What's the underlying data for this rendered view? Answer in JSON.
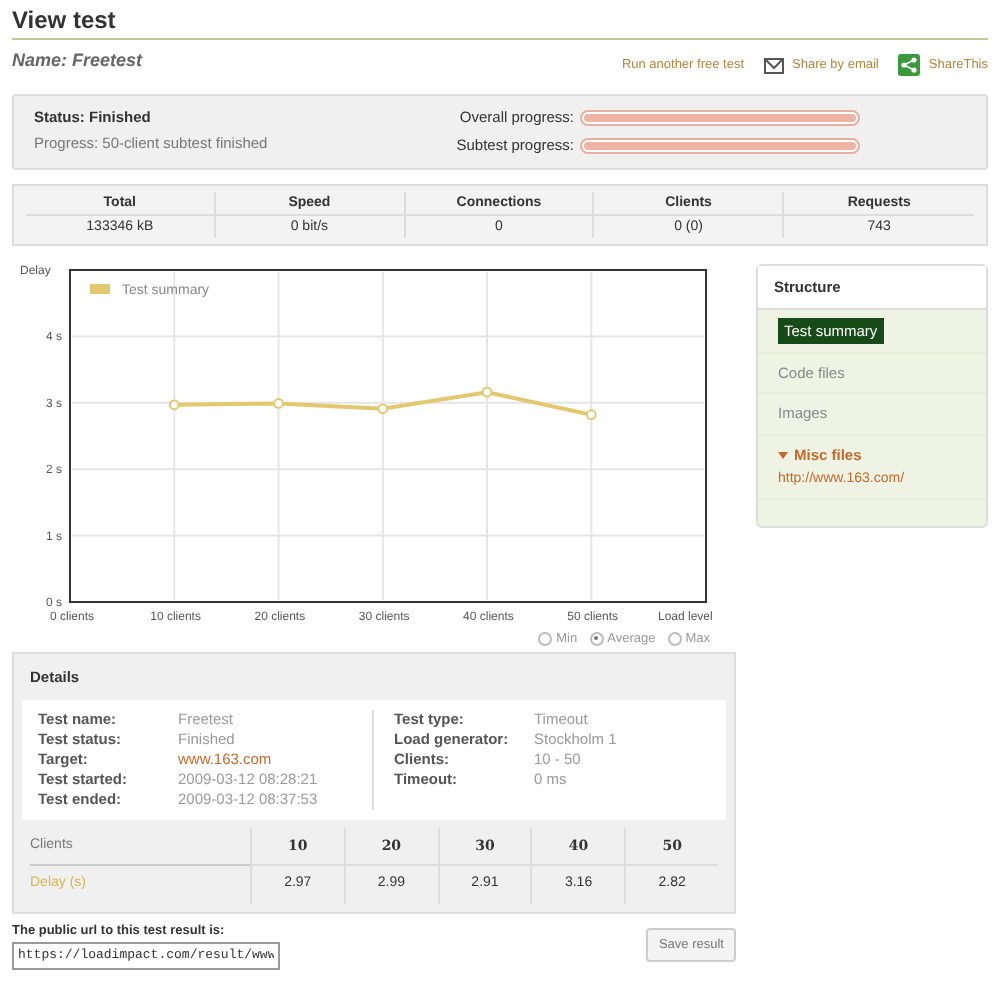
{
  "title": "View test",
  "name": "Name: Freetest",
  "actions": [
    {
      "kind": "link",
      "label": "Run another free test"
    },
    {
      "kind": "email",
      "label": "Share by email"
    },
    {
      "kind": "share",
      "label": "ShareThis"
    }
  ],
  "status": {
    "title": "Status: Finished",
    "progress_text": "Progress: 50-client subtest finished",
    "bars": [
      {
        "label": "Overall progress:",
        "level": 1
      },
      {
        "label": "Subtest progress:",
        "level": 1
      }
    ]
  },
  "stats": {
    "columns": [
      "Total",
      "Speed",
      "Connections",
      "Clients",
      "Requests"
    ],
    "values": [
      "133346 kB",
      "0 bit/s",
      "0",
      "0 (0)",
      "743"
    ]
  },
  "chart": {
    "chart_data": {
      "type": "line",
      "grid": true,
      "ylabel": "Delay",
      "xlabel": "Load level",
      "x": [
        10,
        20,
        30,
        40,
        50
      ],
      "series": [
        {
          "name": "Test summary",
          "color": "#e3c870",
          "marker": "circle",
          "values": [
            2.97,
            2.99,
            2.91,
            3.16,
            2.82
          ]
        }
      ],
      "xlim": [
        0,
        61
      ],
      "ylim": [
        0,
        5
      ],
      "xticks": [
        {
          "value": 0,
          "label": "0 clients"
        },
        {
          "value": 10,
          "label": "10 clients"
        },
        {
          "value": 20,
          "label": "20 clients"
        },
        {
          "value": 30,
          "label": "30 clients"
        },
        {
          "value": 40,
          "label": "40 clients"
        },
        {
          "value": 50,
          "label": "50 clients"
        }
      ],
      "yticks": [
        {
          "value": 0,
          "label": "0 s"
        },
        {
          "value": 1,
          "label": "1 s"
        },
        {
          "value": 2,
          "label": "2 s"
        },
        {
          "value": 3,
          "label": "3 s"
        },
        {
          "value": 4,
          "label": "4 s"
        }
      ]
    },
    "modes": [
      {
        "label": "Min",
        "selected": false
      },
      {
        "label": "Average",
        "selected": true
      },
      {
        "label": "Max",
        "selected": false
      }
    ]
  },
  "structure": {
    "title": "Structure",
    "items": [
      {
        "label": "Test summary",
        "selected": true
      },
      {
        "label": "Code files",
        "selected": false
      },
      {
        "label": "Images",
        "selected": false
      },
      {
        "label": "Misc files",
        "selected": false,
        "expanded": true,
        "children": [
          {
            "label": "http://www.163.com/"
          }
        ]
      }
    ]
  },
  "details": {
    "title": "Details",
    "left": [
      {
        "label": "Test name:",
        "value": "Freetest",
        "kind": "text"
      },
      {
        "label": "Test status:",
        "value": "Finished",
        "kind": "text"
      },
      {
        "label": "Target:",
        "value": "www.163.com",
        "kind": "link"
      },
      {
        "label": "Test started:",
        "value": "2009-03-12 08:28:21",
        "kind": "text"
      },
      {
        "label": "Test ended:",
        "value": "2009-03-12 08:37:53",
        "kind": "text"
      }
    ],
    "right": [
      {
        "label": "Test type:",
        "value": "Timeout"
      },
      {
        "label": "Load generator:",
        "value": "Stockholm 1"
      },
      {
        "label": "Clients:",
        "value": "10 - 50"
      },
      {
        "label": "Timeout:",
        "value": "0 ms"
      }
    ],
    "table": {
      "header": [
        "Clients",
        "10",
        "20",
        "30",
        "40",
        "50"
      ],
      "row": [
        "Delay (s)",
        "2.97",
        "2.99",
        "2.91",
        "3.16",
        "2.82"
      ]
    }
  },
  "public_url": {
    "label": "The public url to this test result is:",
    "value": "https://loadimpact.com/result/www"
  },
  "save_button": "Save result"
}
